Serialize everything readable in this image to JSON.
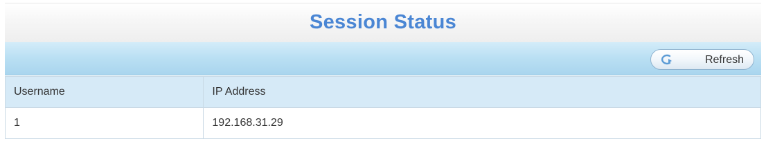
{
  "panel": {
    "title": "Session Status"
  },
  "toolbar": {
    "refresh_label": "Refresh",
    "refresh_icon": "refresh-icon"
  },
  "table": {
    "columns": [
      "Username",
      "IP Address"
    ],
    "rows": [
      [
        "1",
        "192.168.31.29"
      ]
    ]
  },
  "colors": {
    "title": "#4a86d4",
    "toolbar": "#b9dff3",
    "header_row": "#d6eaf7",
    "border": "#c9d9e5"
  }
}
